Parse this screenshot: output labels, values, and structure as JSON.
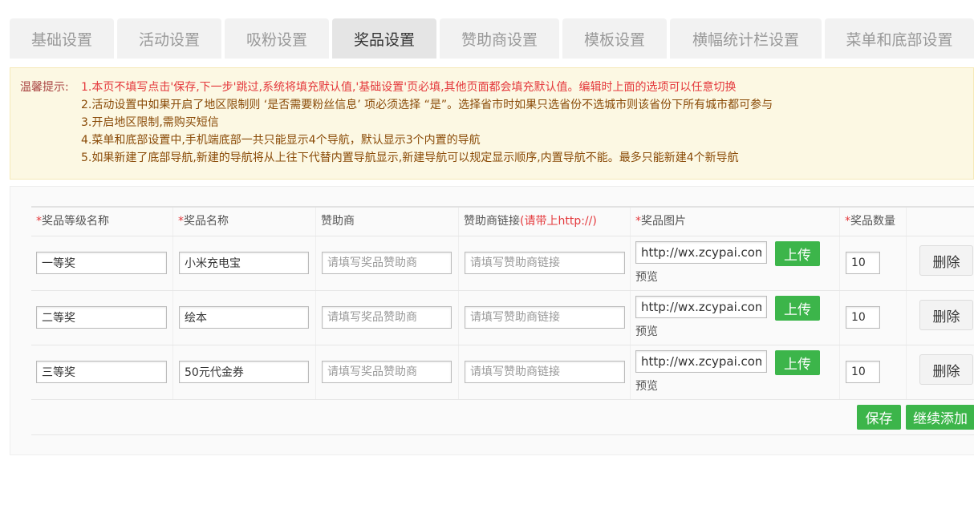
{
  "tabs": [
    {
      "label": "基础设置",
      "active": false
    },
    {
      "label": "活动设置",
      "active": false
    },
    {
      "label": "吸粉设置",
      "active": false
    },
    {
      "label": "奖品设置",
      "active": true
    },
    {
      "label": "赞助商设置",
      "active": false
    },
    {
      "label": "模板设置",
      "active": false
    },
    {
      "label": "横幅统计栏设置",
      "active": false
    },
    {
      "label": "菜单和底部设置",
      "active": false
    }
  ],
  "notice": {
    "label": "温馨提示:",
    "lines": [
      "1.本页不填写点击'保存,下一步'跳过,系统将填充默认值,'基础设置'页必填,其他页面都会填充默认值。编辑时上面的选项可以任意切换",
      "2.活动设置中如果开启了地区限制则 ‘是否需要粉丝信息’ 项必须选择 “是”。选择省市时如果只选省份不选城市则该省份下所有城市都可参与",
      "3.开启地区限制,需购买短信",
      "4.菜单和底部设置中,手机端底部一共只能显示4个导航，默认显示3个内置的导航",
      "5.如果新建了底部导航,新建的导航将从上往下代替内置导航显示,新建导航可以规定显示顺序,内置导航不能。最多只能新建4个新导航"
    ]
  },
  "table": {
    "headers": {
      "level_name": "奖品等级名称",
      "prize_name": "奖品名称",
      "sponsor": "赞助商",
      "sponsor_link": "赞助商链接",
      "sponsor_link_note": "(请带上http://)",
      "prize_image": "奖品图片",
      "prize_quantity": "奖品数量",
      "required_mark": "*"
    },
    "placeholders": {
      "sponsor": "请填写奖品赞助商",
      "sponsor_link": "请填写赞助商链接"
    },
    "rows": [
      {
        "level": "一等奖",
        "name": "小米充电宝",
        "sponsor": "",
        "link": "",
        "image": "http://wx.zcypai.com/",
        "quantity": "10"
      },
      {
        "level": "二等奖",
        "name": "绘本",
        "sponsor": "",
        "link": "",
        "image": "http://wx.zcypai.com/",
        "quantity": "10"
      },
      {
        "level": "三等奖",
        "name": "50元代金券",
        "sponsor": "",
        "link": "",
        "image": "http://wx.zcypai.com/",
        "quantity": "10"
      }
    ],
    "upload_label": "上传",
    "preview_label": "预览",
    "delete_label": "删除"
  },
  "actions": {
    "save_label": "保存",
    "continue_add_label": "继续添加"
  },
  "colors": {
    "accent_green": "#3cb54a",
    "required_red": "#e4393c",
    "notice_bg": "#fcf8e3"
  }
}
